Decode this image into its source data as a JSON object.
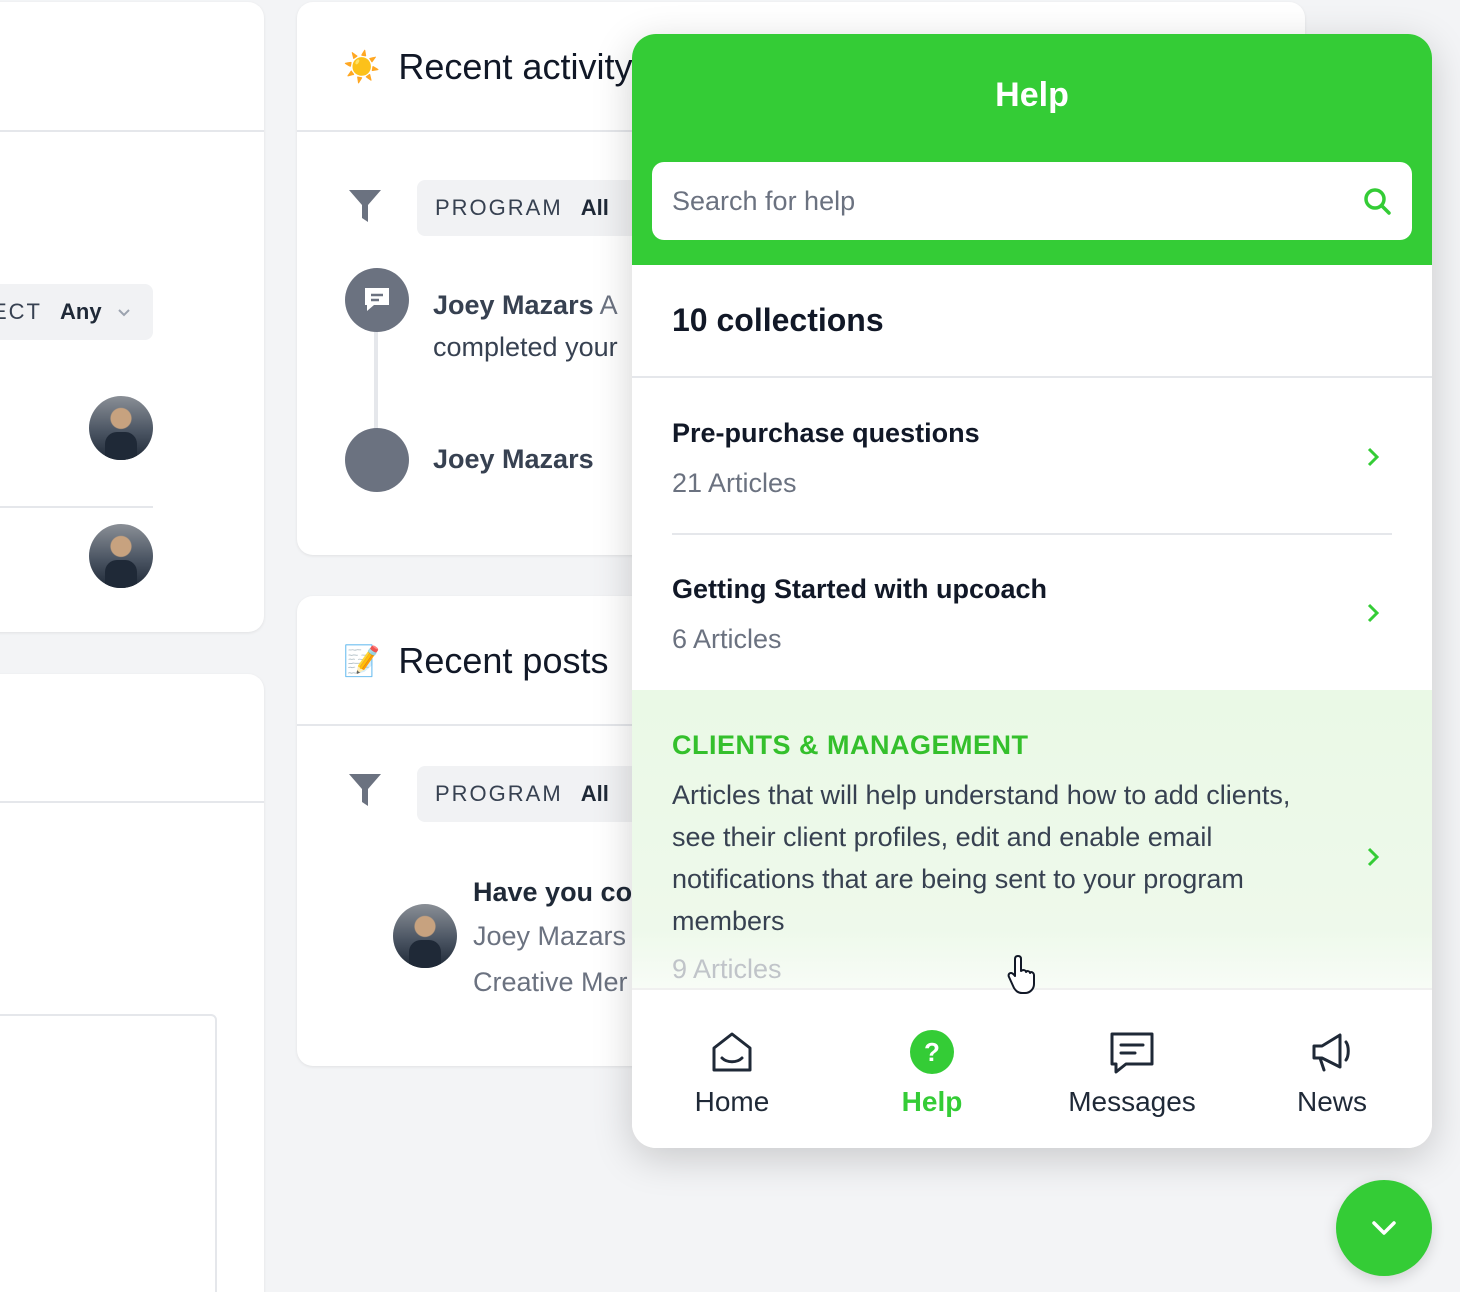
{
  "left_panel": {
    "filter_label": "ECT",
    "filter_value": "Any"
  },
  "recent_activity": {
    "emoji": "☀️",
    "title": "Recent activity",
    "filter_label": "PROGRAM",
    "filter_value": "All",
    "items": [
      {
        "name": "Joey Mazars",
        "text_suffix": "A",
        "line2": "completed your"
      },
      {
        "name": "Joey Mazars"
      }
    ]
  },
  "recent_posts": {
    "emoji": "📝",
    "title": "Recent posts",
    "filter_label": "PROGRAM",
    "filter_value": "All",
    "post": {
      "title": "Have you co",
      "author": "Joey Mazars",
      "meta": "Creative Mer"
    }
  },
  "help_widget": {
    "title": "Help",
    "search_placeholder": "Search for help",
    "collections_count": "10 collections",
    "collections": [
      {
        "title": "Pre-purchase questions",
        "articles": "21 Articles"
      },
      {
        "title": "Getting Started with upcoach",
        "articles": "6 Articles"
      },
      {
        "title": "CLIENTS & MANAGEMENT",
        "description": "Articles that will help understand how to add clients, see their client profiles, edit and enable email notifications that are being sent to your program members",
        "articles": "9 Articles"
      }
    ],
    "nav": [
      {
        "label": "Home",
        "icon": "home-icon"
      },
      {
        "label": "Help",
        "icon": "help-icon",
        "active": true
      },
      {
        "label": "Messages",
        "icon": "messages-icon"
      },
      {
        "label": "News",
        "icon": "megaphone-icon"
      }
    ],
    "accent_color": "#34cc36"
  }
}
